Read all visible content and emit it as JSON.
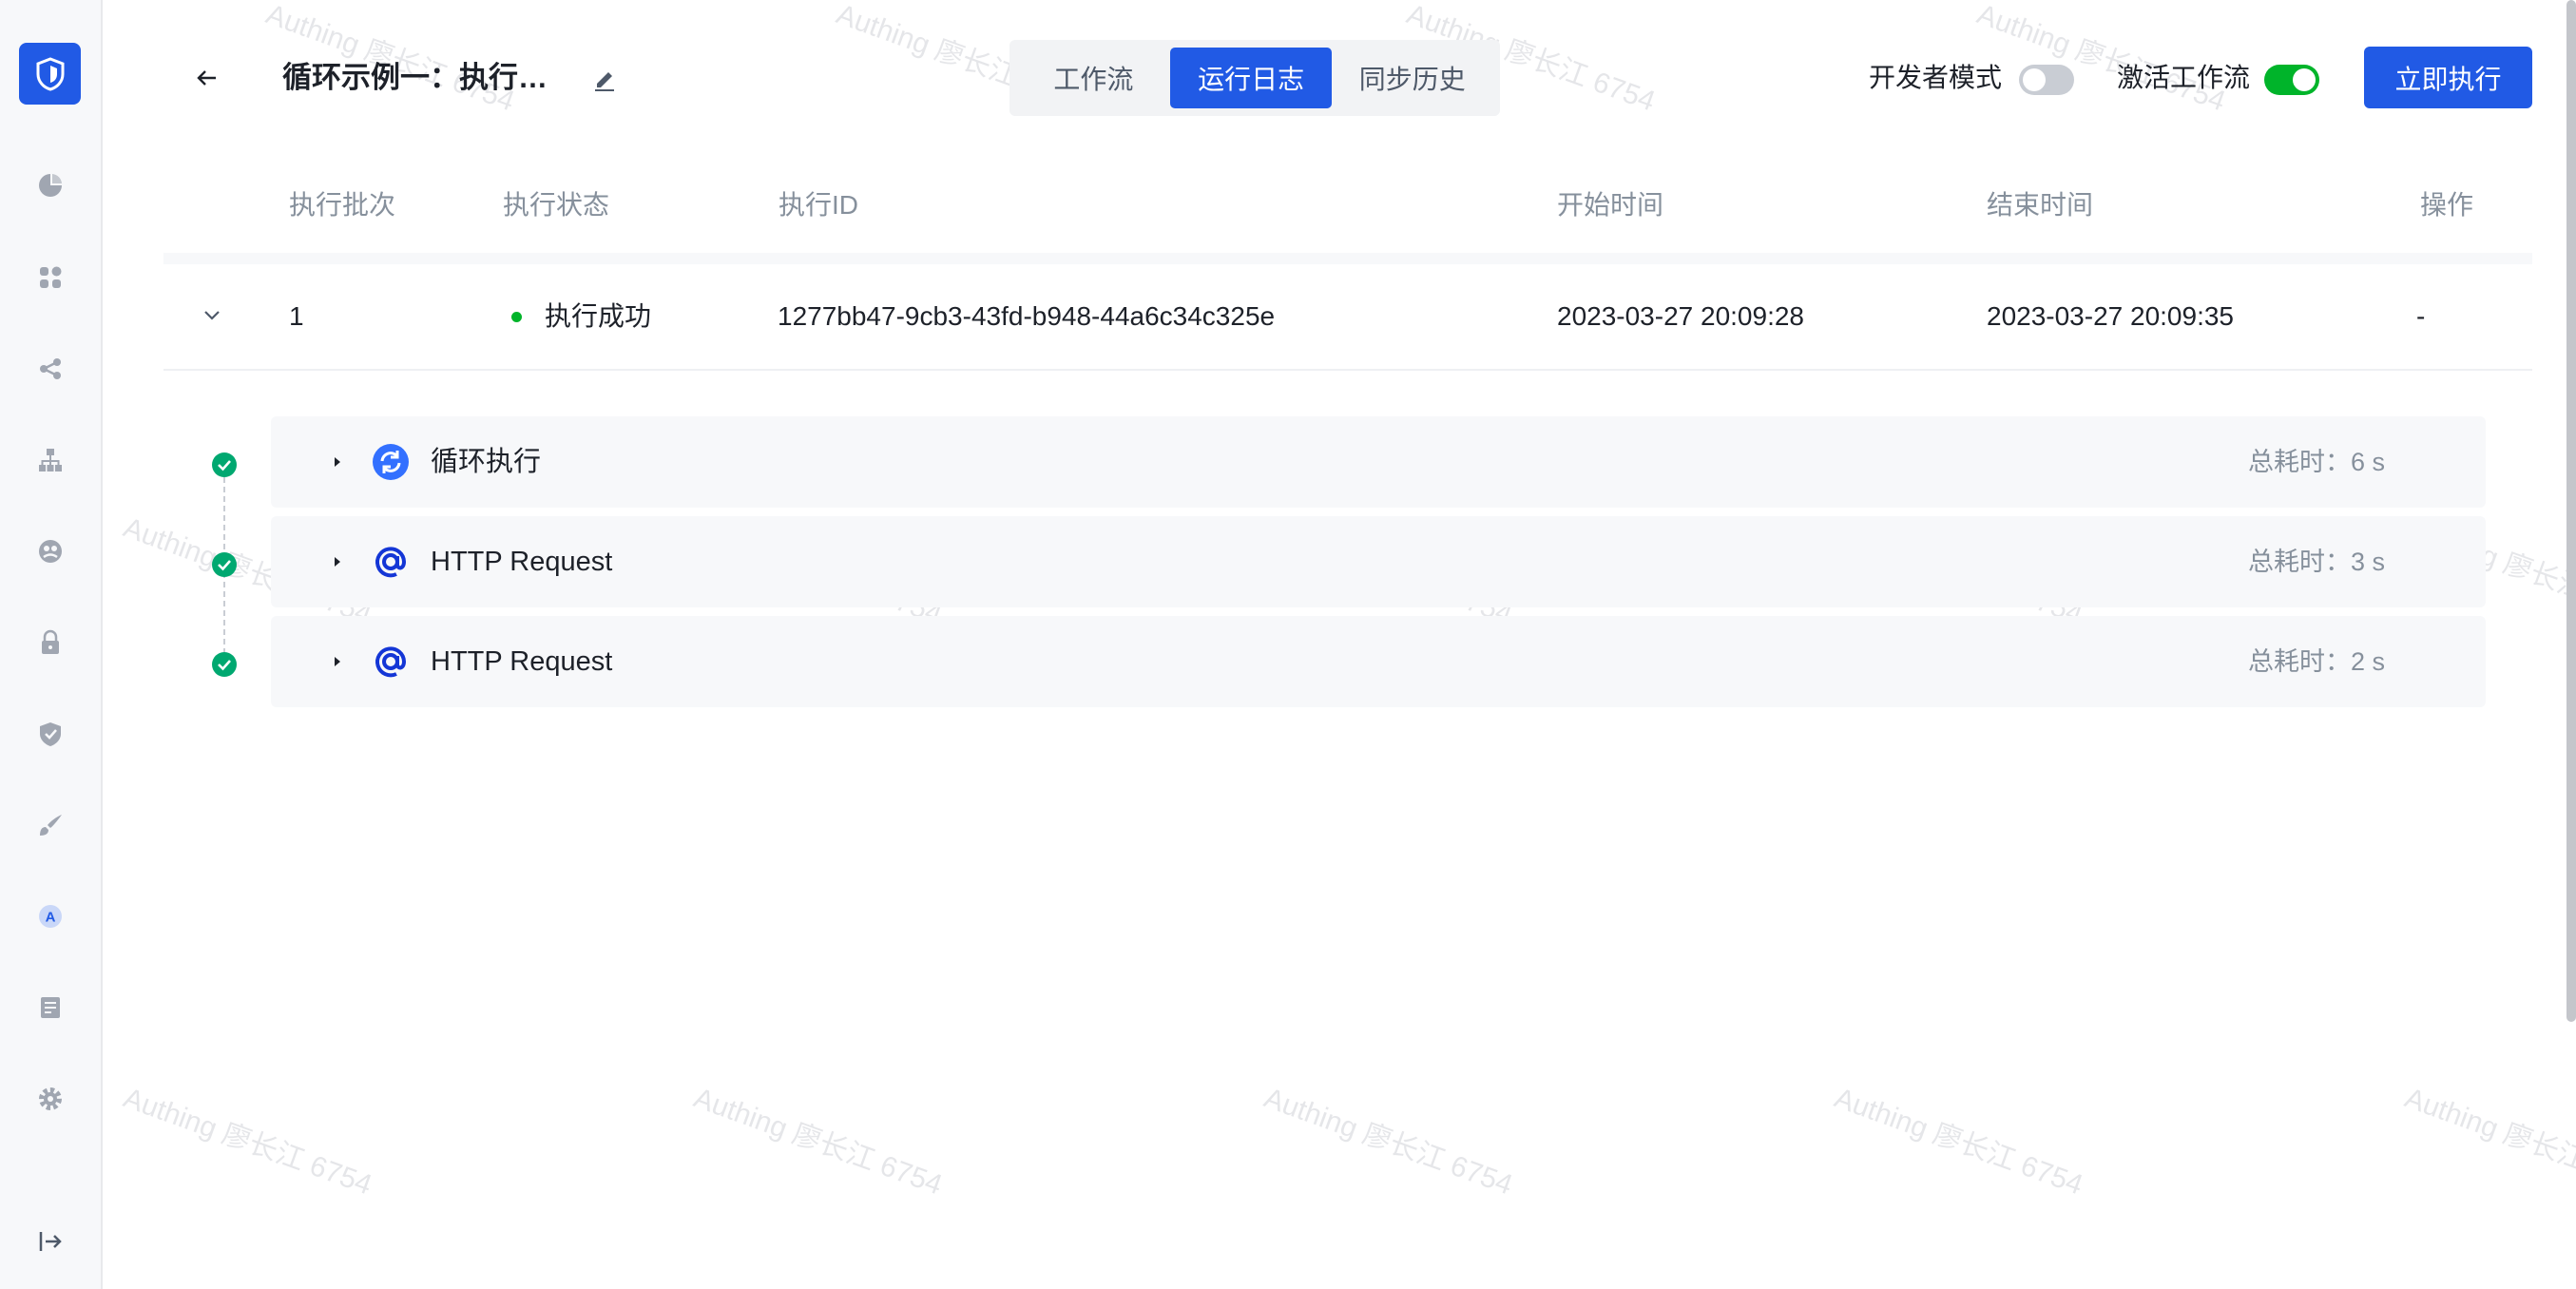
{
  "sidebar": {
    "logo_icon": "shield-logo-icon",
    "items": [
      {
        "icon": "pie-chart-icon"
      },
      {
        "icon": "apps-grid-icon"
      },
      {
        "icon": "share-icon"
      },
      {
        "icon": "org-tree-icon"
      },
      {
        "icon": "users-icon"
      },
      {
        "icon": "lock-icon"
      },
      {
        "icon": "shield-check-icon"
      },
      {
        "icon": "brush-icon"
      },
      {
        "icon": "branding-a-icon"
      },
      {
        "icon": "audit-log-icon"
      },
      {
        "icon": "settings-gear-icon"
      }
    ],
    "collapse_icon": "collapse-sidebar-icon"
  },
  "header": {
    "title": "循环示例一：执行…",
    "tabs": [
      {
        "label": "工作流",
        "active": false
      },
      {
        "label": "运行日志",
        "active": true
      },
      {
        "label": "同步历史",
        "active": false
      }
    ],
    "dev_mode_label": "开发者模式",
    "dev_mode_on": false,
    "activate_label": "激活工作流",
    "activate_on": true,
    "run_button": "立即执行"
  },
  "table": {
    "columns": [
      "执行批次",
      "执行状态",
      "执行ID",
      "开始时间",
      "结束时间",
      "操作"
    ],
    "rows": [
      {
        "batch": "1",
        "status": "执行成功",
        "exec_id": "1277bb47-9cb3-43fd-b948-44a6c34c325e",
        "start": "2023-03-27 20:09:28",
        "end": "2023-03-27 20:09:35",
        "action": "-"
      }
    ]
  },
  "steps": [
    {
      "name": "循环执行",
      "time": "总耗时：6 s",
      "icon": "loop-icon"
    },
    {
      "name": "HTTP Request",
      "time": "总耗时：3 s",
      "icon": "at-sign-icon"
    },
    {
      "name": "HTTP Request",
      "time": "总耗时：2 s",
      "icon": "at-sign-icon"
    }
  ],
  "watermark": "Authing 廖长江 6754",
  "colors": {
    "primary": "#215ae5",
    "success": "#00b42a"
  }
}
